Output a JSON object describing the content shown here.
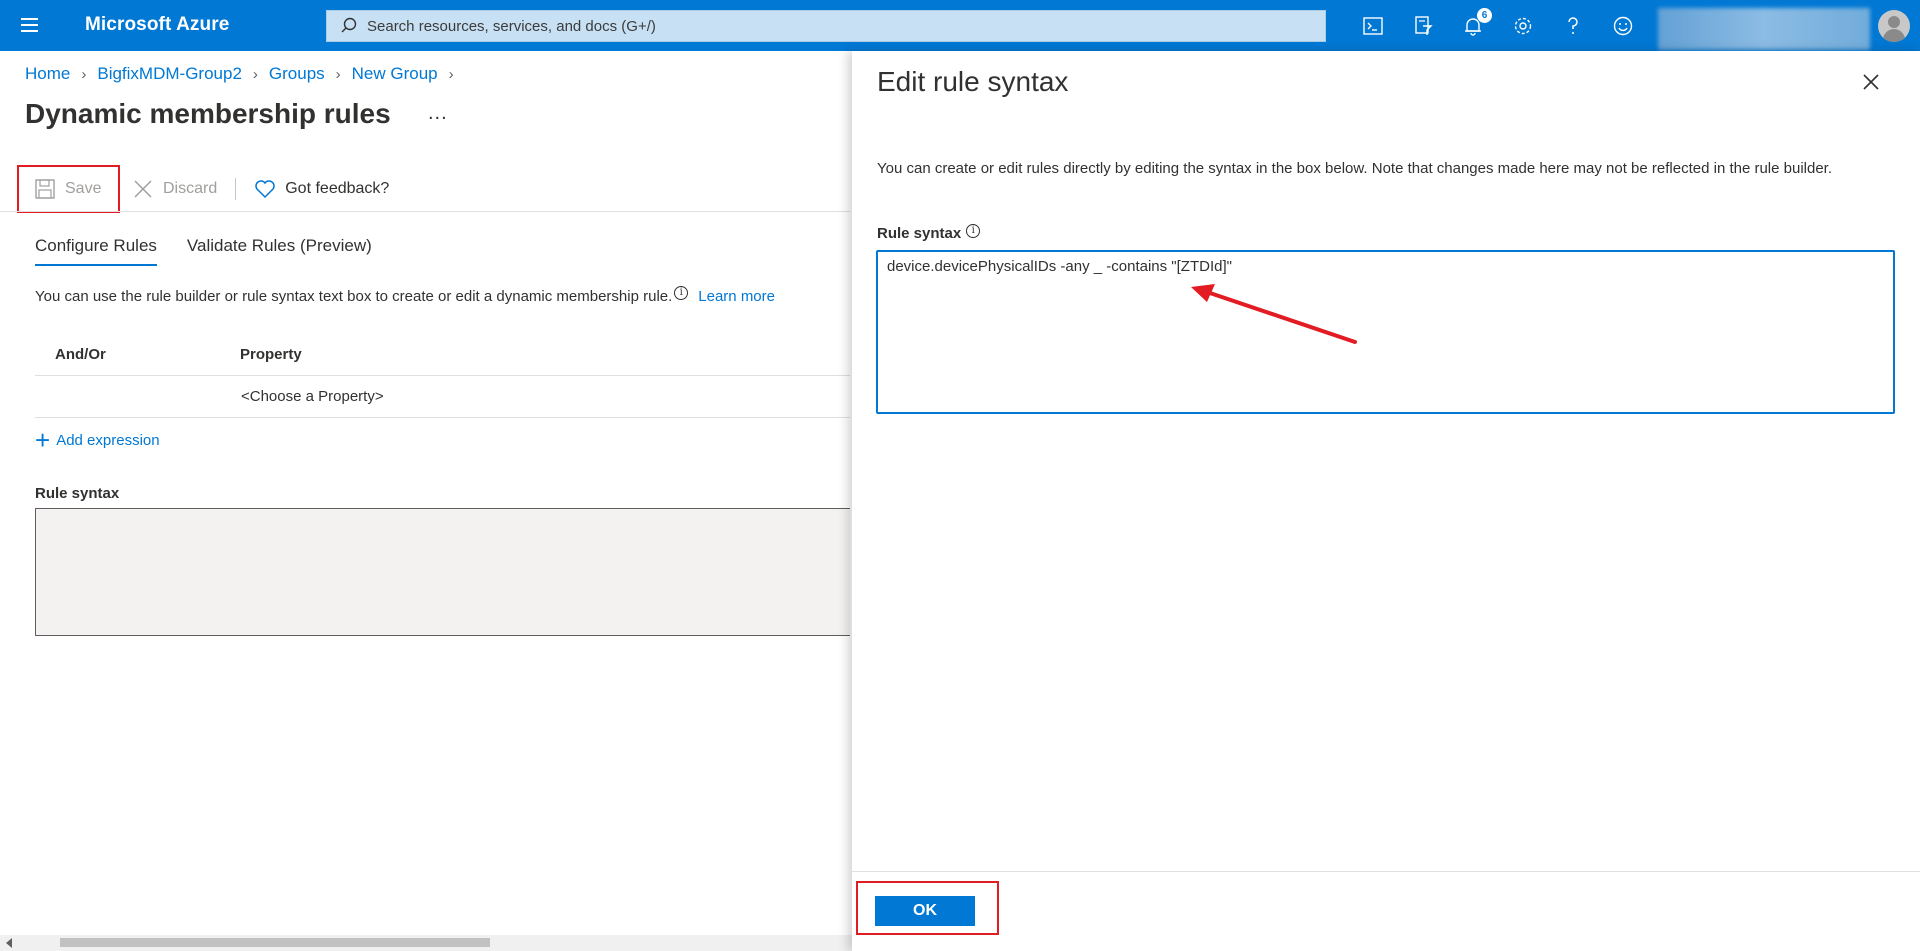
{
  "topbar": {
    "brand": "Microsoft Azure",
    "search_placeholder": "Search resources, services, and docs (G+/)",
    "notification_count": "6",
    "icons": [
      "cloud-shell-icon",
      "directory-filter-icon",
      "notifications-icon",
      "settings-icon",
      "help-icon",
      "feedback-smiley-icon"
    ]
  },
  "breadcrumb": {
    "items": [
      "Home",
      "BigfixMDM-Group2",
      "Groups",
      "New Group"
    ]
  },
  "page": {
    "title": "Dynamic membership rules",
    "more": "..."
  },
  "commands": {
    "save": "Save",
    "discard": "Discard",
    "feedback": "Got feedback?"
  },
  "tabs": [
    {
      "label": "Configure Rules",
      "active": true
    },
    {
      "label": "Validate Rules (Preview)",
      "active": false
    }
  ],
  "description": {
    "text": "You can use the rule builder or rule syntax text box to create or edit a dynamic membership rule.",
    "info": "i",
    "learn_more": "Learn more"
  },
  "grid": {
    "headers": [
      "And/Or",
      "Property"
    ],
    "rows": [
      {
        "and_or": "",
        "property": "<Choose a Property>"
      }
    ]
  },
  "add_expression": "Add expression",
  "rule_syntax_label": "Rule syntax",
  "panel": {
    "title": "Edit rule syntax",
    "description": "You can create or edit rules directly by editing the syntax in the box below. Note that changes made here may not be reflected in the rule builder.",
    "label": "Rule syntax",
    "info": "i",
    "syntax_value": "device.devicePhysicalIDs -any _ -contains \"[ZTDId]\"",
    "ok": "OK"
  },
  "colors": {
    "brand_blue": "#0078d4",
    "highlight_red": "#e31b23"
  }
}
